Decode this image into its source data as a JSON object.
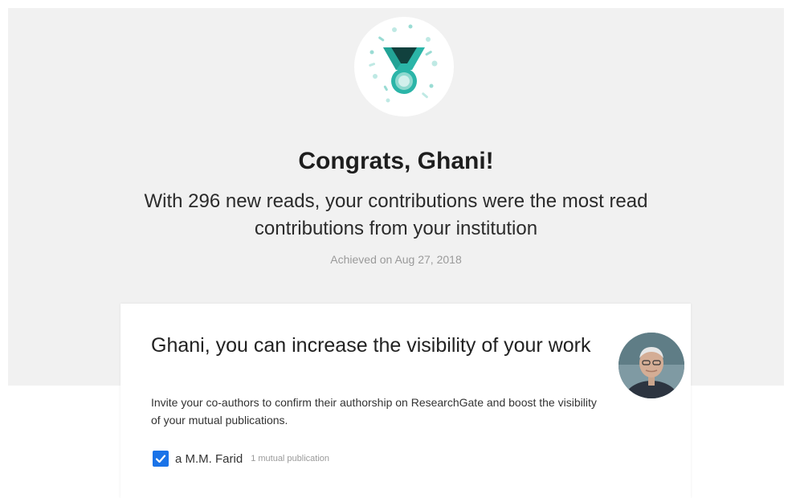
{
  "header": {
    "badge_icon": "medal-icon",
    "title": "Congrats, Ghani!",
    "message": "With 296 new reads, your contributions were the most read contributions from your institution",
    "achieved": "Achieved on Aug 27, 2018"
  },
  "card": {
    "title": "Ghani, you can increase the visibility of your work",
    "description": "Invite your co-authors to confirm their authorship on ResearchGate and boost the visibility of your mutual publications.",
    "avatar_icon": "avatar",
    "coauthor": {
      "checked": true,
      "name": "a M.M. Farid",
      "meta": "1 mutual publication"
    }
  },
  "colors": {
    "accent": "#1a73e8",
    "teal": "#2bb5a8",
    "teal_dark": "#11413e",
    "hero_bg": "#f1f1f1"
  }
}
